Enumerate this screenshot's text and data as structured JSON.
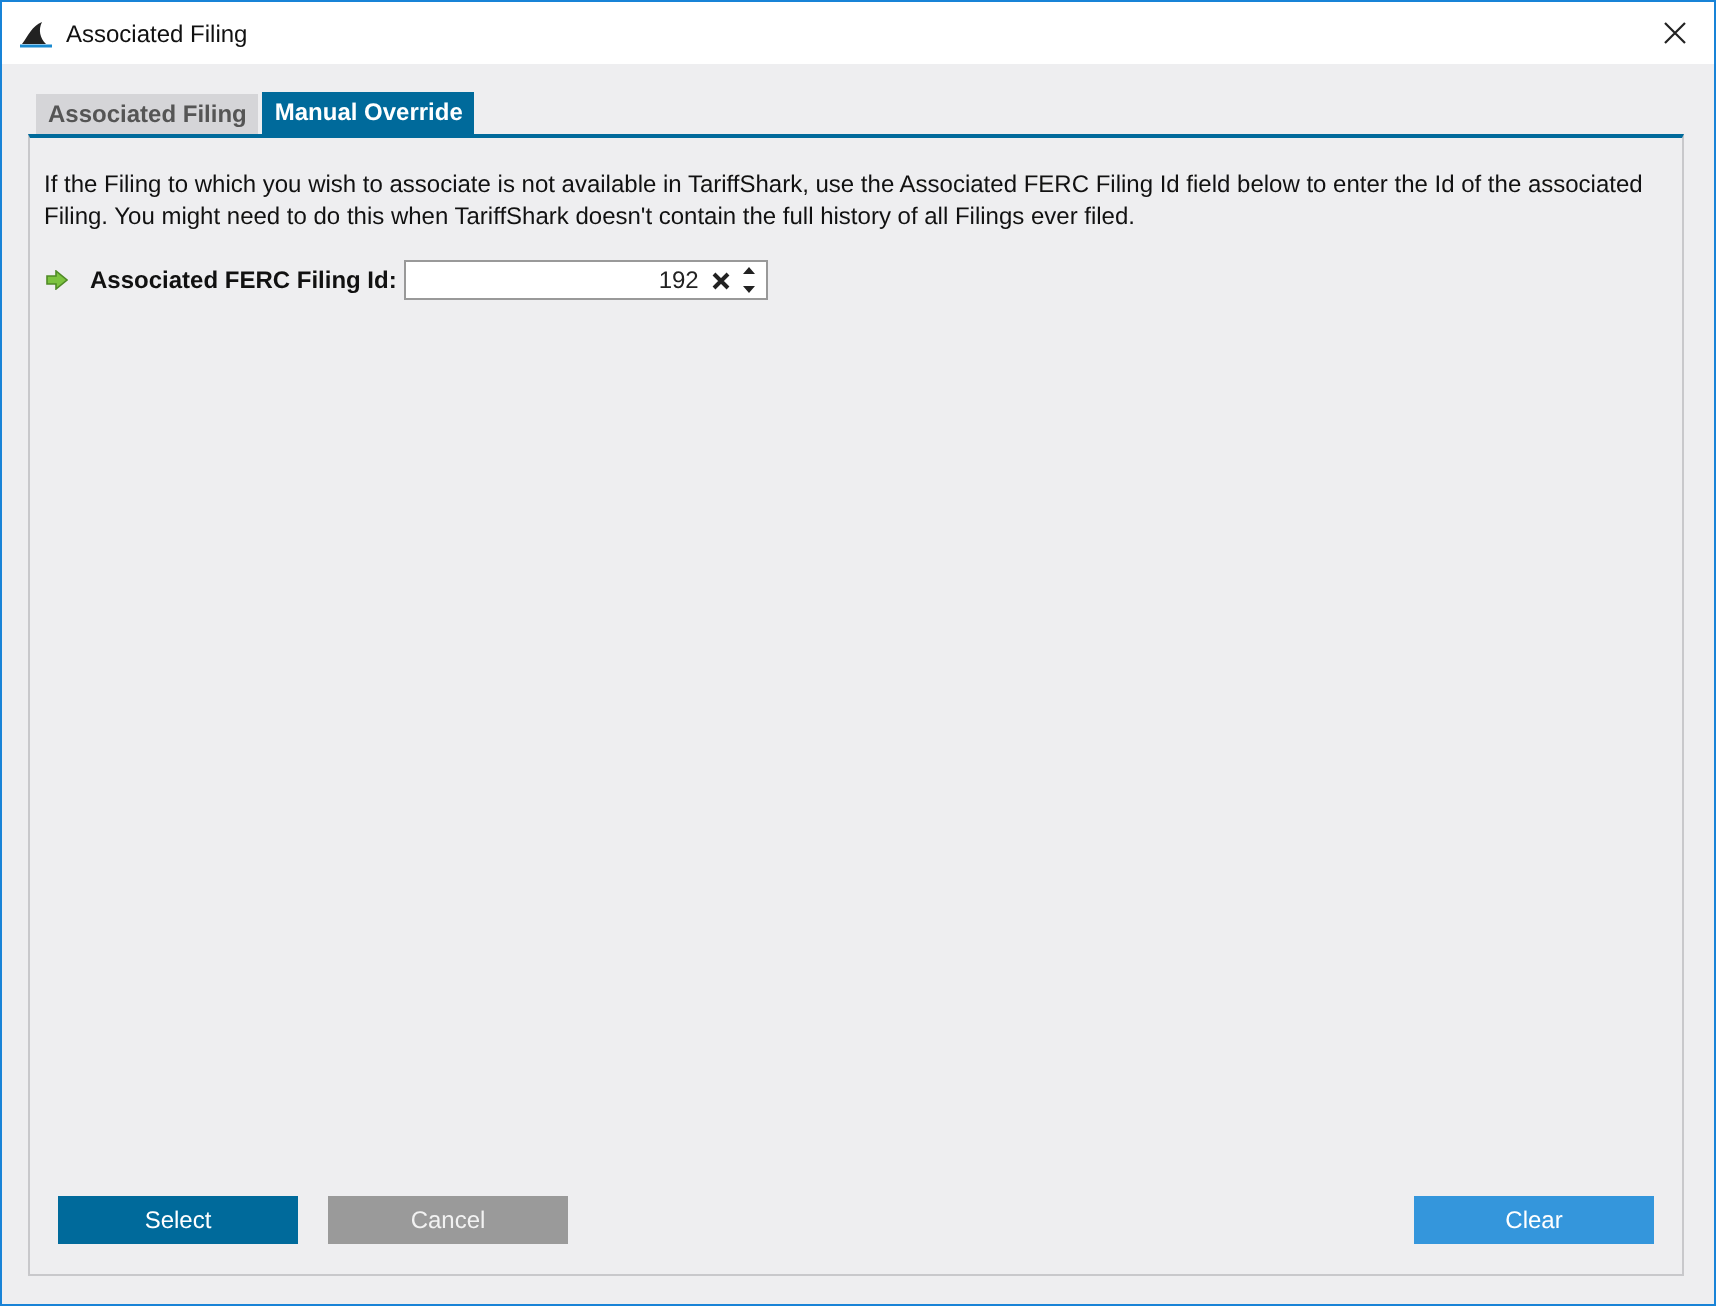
{
  "window": {
    "title": "Associated Filing"
  },
  "tabs": [
    {
      "label": "Associated Filing",
      "selected": false
    },
    {
      "label": "Manual Override",
      "selected": true
    }
  ],
  "description": "If the Filing to which you wish to associate is not available in TariffShark, use the Associated FERC Filing Id field below to enter the Id of the associated Filing. You might need to do this when TariffShark doesn't contain the full history of all Filings ever filed.",
  "field": {
    "label": "Associated FERC Filing Id:",
    "value": "192"
  },
  "buttons": [
    {
      "label": "Select",
      "kind": "primary",
      "disabled": false
    },
    {
      "label": "Cancel",
      "kind": "primary",
      "disabled": true
    },
    {
      "label": "Clear",
      "kind": "accent",
      "disabled": false
    }
  ]
}
